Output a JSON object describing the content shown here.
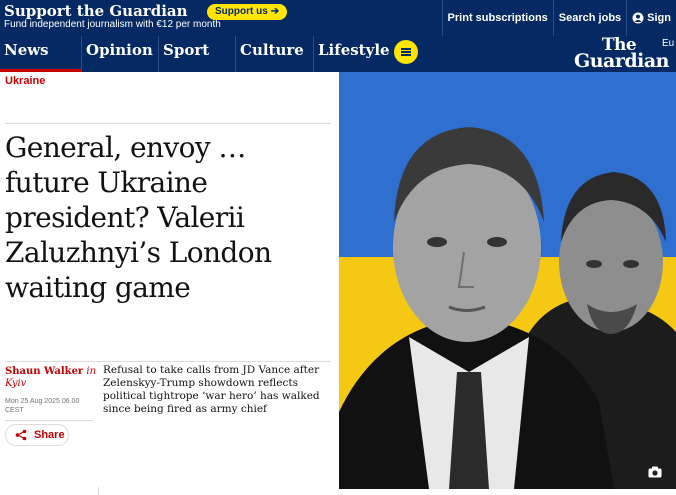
{
  "support_bar": {
    "title": "Support the Guardian",
    "subtitle": "Fund independent journalism with €12 per month",
    "button_label": "Support us",
    "links": [
      "Print subscriptions",
      "Search jobs",
      "Sign"
    ]
  },
  "nav": {
    "items": [
      "News",
      "Opinion",
      "Sport",
      "Culture",
      "Lifestyle"
    ],
    "active": "News"
  },
  "logo": {
    "line1": "The",
    "line2": "Guardian"
  },
  "edition": "Eu",
  "article": {
    "kicker": "Ukraine",
    "headline": "General, envoy … future Ukraine president? Valerii Zaluzhnyi’s London waiting game",
    "author": "Shaun Walker",
    "author_in": "in",
    "location": "Kyiv",
    "date": "Mon 25 Aug 2025 06.00 CEST",
    "share_label": "Share",
    "standfirst": "Refusal to take calls from JD Vance after Zelenskyy-Trump showdown reflects political tightrope ‘war hero’ has walked since being fired as army chief"
  },
  "colors": {
    "brand": "#052962",
    "support_yellow": "#ffe500",
    "news_red": "#c70000",
    "flag_blue": "#2f6fd0",
    "flag_yellow": "#f5c814"
  },
  "icons": {
    "menu": "hamburger-icon",
    "share": "share-icon",
    "camera": "camera-icon",
    "account": "account-icon"
  }
}
